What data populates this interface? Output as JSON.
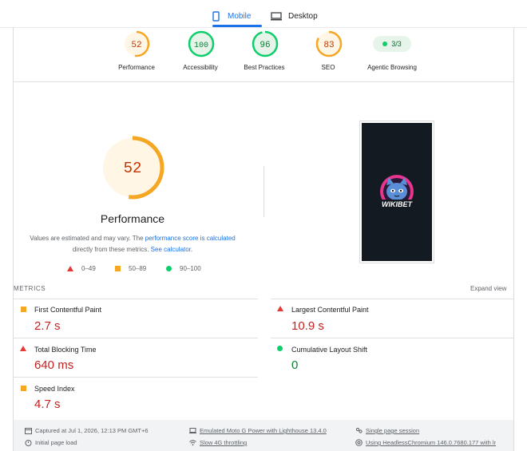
{
  "tabs": [
    {
      "label": "Mobile",
      "active": true
    },
    {
      "label": "Desktop",
      "active": false
    }
  ],
  "scores": [
    {
      "value": "52",
      "label": "Performance",
      "color": "#f5a623"
    },
    {
      "value": "100",
      "label": "Accessibility",
      "color": "#0cce6b"
    },
    {
      "value": "96",
      "label": "Best Practices",
      "color": "#0cce6b"
    },
    {
      "value": "83",
      "label": "SEO",
      "color": "#f5a623"
    }
  ],
  "agentic": {
    "value": "3/3",
    "label": "Agentic Browsing"
  },
  "performance": {
    "score": "52",
    "title": "Performance",
    "note_before": "Values are estimated and may vary. The ",
    "note_link1": "performance score is calculated",
    "note_middle": " directly from these metrics. ",
    "note_link2": "See calculator."
  },
  "legend": [
    {
      "shape": "triangle",
      "range": "0–49"
    },
    {
      "shape": "square",
      "range": "50–89"
    },
    {
      "shape": "circle",
      "range": "90–100"
    }
  ],
  "phone": {
    "brand": "WIKIBET"
  },
  "metrics": {
    "header": "METRICS",
    "expand": "Expand view",
    "items": [
      {
        "label": "First Contentful Paint",
        "value": "2.7 s",
        "rating": "average"
      },
      {
        "label": "Largest Contentful Paint",
        "value": "10.9 s",
        "rating": "fail"
      },
      {
        "label": "Total Blocking Time",
        "value": "640 ms",
        "rating": "fail"
      },
      {
        "label": "Cumulative Layout Shift",
        "value": "0",
        "rating": "pass"
      },
      {
        "label": "Speed Index",
        "value": "4.7 s",
        "rating": "average"
      }
    ]
  },
  "footer": {
    "captured": "Captured at Jul 1, 2026, 12:13 PM GMT+6",
    "load": "Initial page load",
    "device": "Emulated Moto G Power with Lighthouse 13.4.0",
    "throttle": "Slow 4G throttling",
    "session": "Single page session",
    "browser": "Using HeadlessChromium 146.0.7680.177 with lr"
  },
  "colors": {
    "accent": "#1a73e8",
    "pass": "#0cce6b",
    "average": "#f5a623",
    "fail": "#e53935"
  }
}
